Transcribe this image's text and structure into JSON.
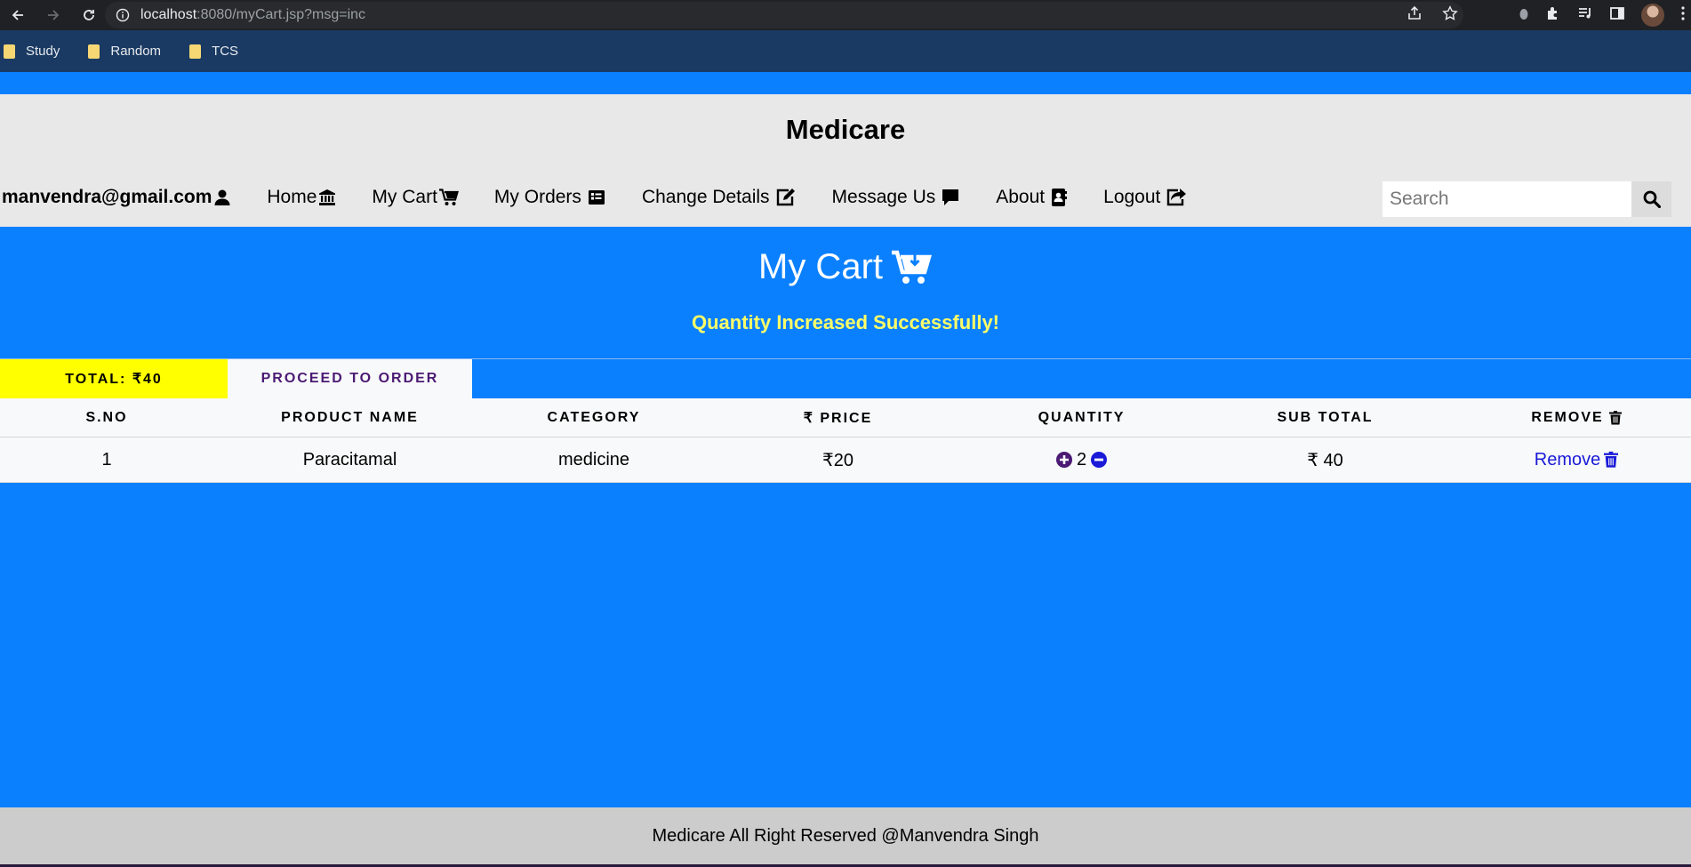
{
  "browser": {
    "url_host": "localhost",
    "url_rest": ":8080/myCart.jsp?msg=inc",
    "bookmarks": [
      "Study",
      "Random",
      "TCS"
    ]
  },
  "header": {
    "brand": "Medicare",
    "user_email": "manvendra@gmail.com",
    "nav": [
      {
        "label": "Home",
        "icon": "bank-icon"
      },
      {
        "label": "My Cart",
        "icon": "cart-icon"
      },
      {
        "label": "My Orders",
        "icon": "list-icon"
      },
      {
        "label": "Change Details",
        "icon": "edit-icon"
      },
      {
        "label": "Message Us",
        "icon": "comment-icon"
      },
      {
        "label": "About",
        "icon": "address-book-icon"
      },
      {
        "label": "Logout",
        "icon": "share-icon"
      }
    ],
    "search_placeholder": "Search"
  },
  "cart": {
    "title": "My Cart",
    "flash_message": "Quantity Increased Successfully!",
    "total_label": "TOTAL: ₹40",
    "proceed_label": "PROCEED TO ORDER",
    "columns": [
      "S.NO",
      "PRODUCT NAME",
      "CATEGORY",
      "₹ PRICE",
      "QUANTITY",
      "SUB TOTAL",
      "REMOVE"
    ],
    "rows": [
      {
        "sno": "1",
        "name": "Paracitamal",
        "category": "medicine",
        "price": "₹20",
        "quantity": "2",
        "subtotal": "₹ 40",
        "remove": "Remove"
      }
    ]
  },
  "footer": {
    "text": "Medicare All Right Reserved @Manvendra Singh"
  },
  "colors": {
    "page_bg": "#0a80ff",
    "header_bg": "#e8e8e8",
    "flash": "#ffff66",
    "total_bg": "#ffff00",
    "proceed_text": "#4b1a74",
    "remove_link": "#1a1ad8",
    "qty_plus": "#4b1a74",
    "qty_minus": "#1a1ad8",
    "footer_bg": "#cccccc"
  }
}
